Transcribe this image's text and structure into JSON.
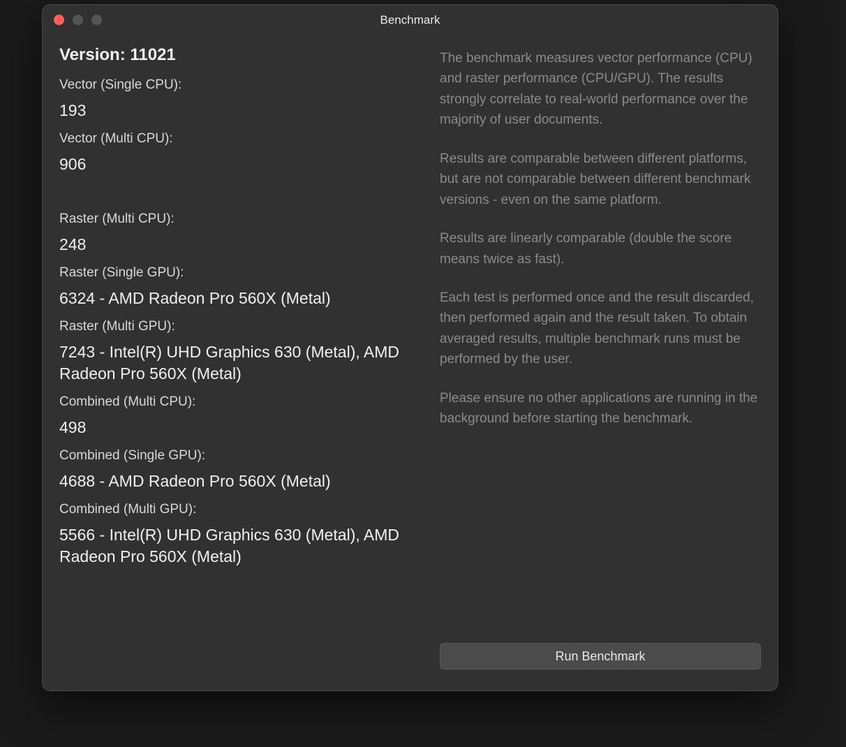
{
  "window": {
    "title": "Benchmark"
  },
  "results": {
    "version_label": "Version: 11021",
    "vector_single_cpu": {
      "label": "Vector (Single CPU):",
      "value": "193"
    },
    "vector_multi_cpu": {
      "label": "Vector (Multi CPU):",
      "value": "906"
    },
    "raster_multi_cpu": {
      "label": "Raster (Multi CPU):",
      "value": "248"
    },
    "raster_single_gpu": {
      "label": "Raster (Single GPU):",
      "value": "6324 - AMD Radeon Pro 560X (Metal)"
    },
    "raster_multi_gpu": {
      "label": "Raster (Multi GPU):",
      "value": "7243 - Intel(R) UHD Graphics 630 (Metal), AMD Radeon Pro 560X (Metal)"
    },
    "combined_multi_cpu": {
      "label": "Combined (Multi CPU):",
      "value": "498"
    },
    "combined_single_gpu": {
      "label": "Combined (Single GPU):",
      "value": "4688 - AMD Radeon Pro 560X (Metal)"
    },
    "combined_multi_gpu": {
      "label": "Combined (Multi GPU):",
      "value": "5566 - Intel(R) UHD Graphics 630 (Metal), AMD Radeon Pro 560X (Metal)"
    }
  },
  "description": {
    "p1": "The benchmark measures vector performance (CPU) and raster performance (CPU/GPU). The results strongly correlate to real-world performance over the majority of user documents.",
    "p2": "Results are comparable between different platforms, but are not comparable between different benchmark versions - even on the same platform.",
    "p3": "Results are linearly comparable (double the score means twice as fast).",
    "p4": "Each test is performed once and the result discarded, then performed again and the result taken. To obtain averaged results, multiple benchmark runs must be performed by the user.",
    "p5": "Please ensure no other applications are running in the background before starting the benchmark."
  },
  "actions": {
    "run_label": "Run Benchmark"
  }
}
